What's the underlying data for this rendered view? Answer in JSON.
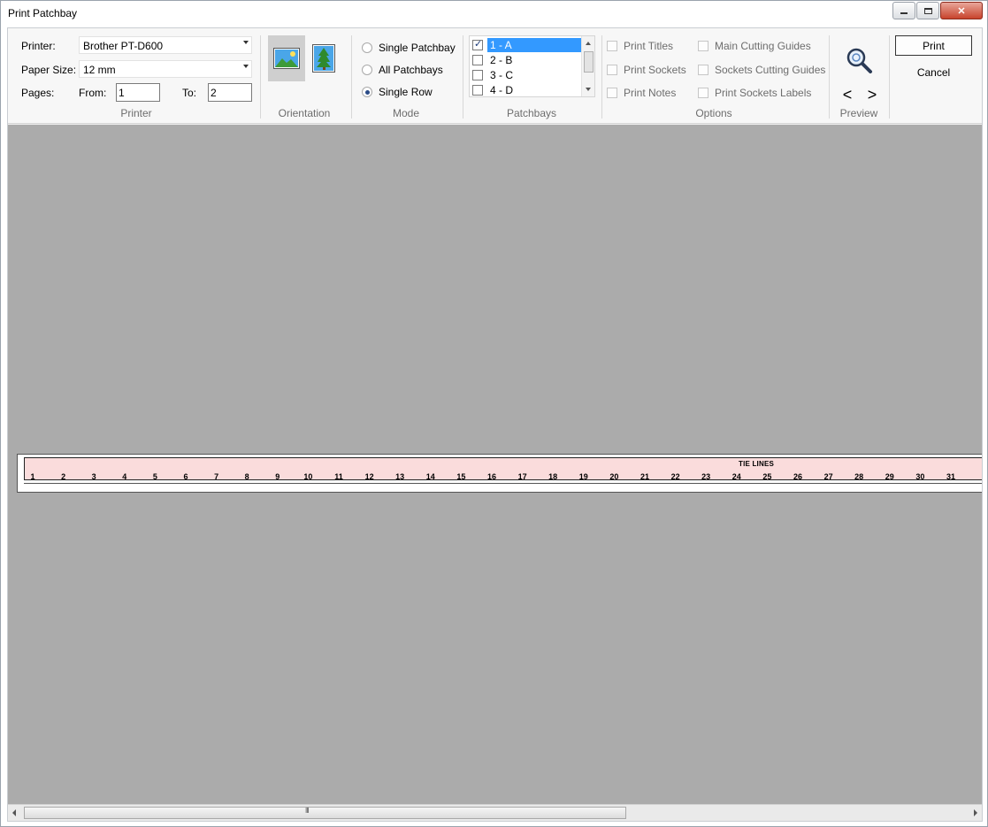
{
  "window": {
    "title": "Print Patchbay"
  },
  "printer_group": {
    "printer_label": "Printer:",
    "printer_value": "Brother PT-D600",
    "paper_label": "Paper Size:",
    "paper_value": "12 mm",
    "pages_label": "Pages:",
    "from_label": "From:",
    "from_value": "1",
    "to_label": "To:",
    "to_value": "2",
    "group_label": "Printer"
  },
  "orientation_group": {
    "group_label": "Orientation",
    "selected": "landscape"
  },
  "mode_group": {
    "group_label": "Mode",
    "options": [
      {
        "label": "Single Patchbay",
        "selected": false
      },
      {
        "label": "All Patchbays",
        "selected": false
      },
      {
        "label": "Single Row",
        "selected": true
      }
    ]
  },
  "patchbays_group": {
    "group_label": "Patchbays",
    "items": [
      {
        "label": "1 - A",
        "checked": true,
        "selected": true
      },
      {
        "label": "2 - B",
        "checked": false,
        "selected": false
      },
      {
        "label": "3 - C",
        "checked": false,
        "selected": false
      },
      {
        "label": "4 - D",
        "checked": false,
        "selected": false
      }
    ]
  },
  "options_group": {
    "group_label": "Options",
    "print_titles": "Print Titles",
    "print_sockets": "Print Sockets",
    "print_notes": "Print Notes",
    "main_cutting_guides": "Main Cutting Guides",
    "sockets_cutting_guides": "Sockets Cutting Guides",
    "print_sockets_labels": "Print Sockets Labels"
  },
  "preview_group": {
    "group_label": "Preview",
    "prev_glyph": "<",
    "next_glyph": ">"
  },
  "actions": {
    "print_label": "Print",
    "cancel_label": "Cancel"
  },
  "preview": {
    "strip_title": "TIE LINES",
    "numbers": [
      "1",
      "2",
      "3",
      "4",
      "5",
      "6",
      "7",
      "8",
      "9",
      "10",
      "11",
      "12",
      "13",
      "14",
      "15",
      "16",
      "17",
      "18",
      "19",
      "20",
      "21",
      "22",
      "23",
      "24",
      "25",
      "26",
      "27",
      "28",
      "29",
      "30",
      "31"
    ]
  },
  "scrollbar": {
    "grip": "III"
  },
  "colors": {
    "preview_bg": "#ababab",
    "label_fill": "#fadcdc",
    "selection": "#3399ff"
  }
}
